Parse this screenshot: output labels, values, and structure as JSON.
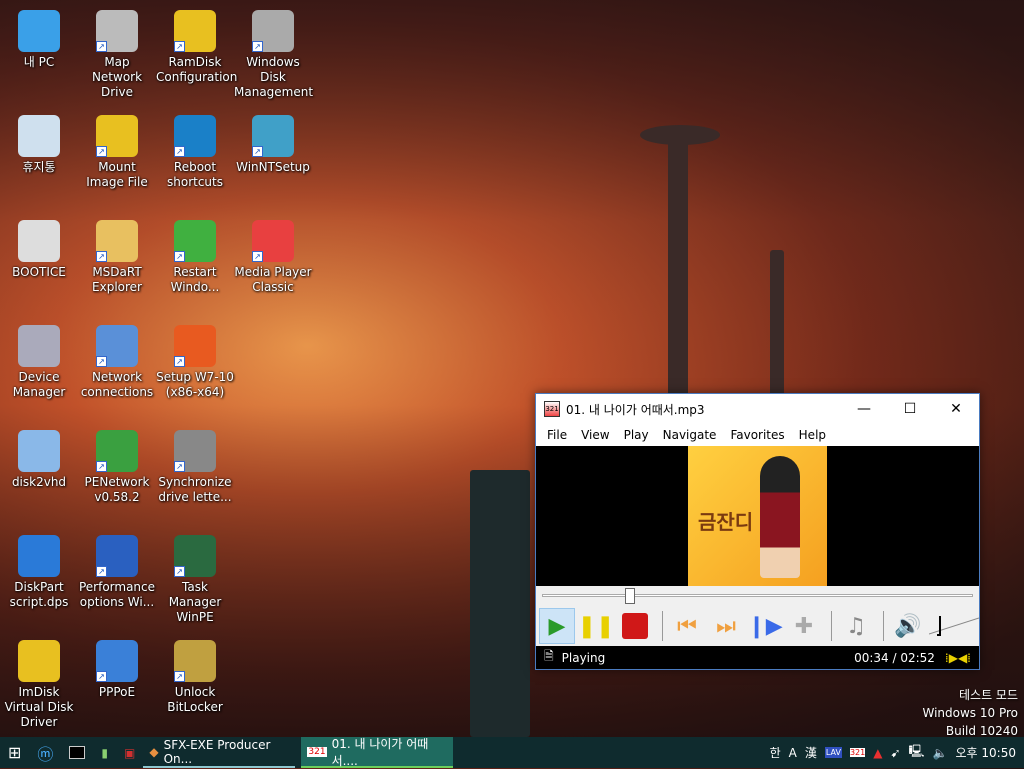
{
  "desktop": {
    "icons": [
      {
        "label": "내 PC",
        "col": 0,
        "row": 0,
        "color": "#3aa0e8",
        "shortcut": false
      },
      {
        "label": "휴지통",
        "col": 0,
        "row": 1,
        "color": "#cfe0ee",
        "shortcut": false
      },
      {
        "label": "BOOTICE",
        "col": 0,
        "row": 2,
        "color": "#ddd",
        "shortcut": false
      },
      {
        "label": "Device Manager",
        "col": 0,
        "row": 3,
        "color": "#aab",
        "shortcut": false
      },
      {
        "label": "disk2vhd",
        "col": 0,
        "row": 4,
        "color": "#8ab8e8",
        "shortcut": false
      },
      {
        "label": "DiskPart script.dps",
        "col": 0,
        "row": 5,
        "color": "#2a7ad8",
        "shortcut": false
      },
      {
        "label": "ImDisk Virtual Disk Driver",
        "col": 0,
        "row": 6,
        "color": "#e8c020",
        "shortcut": false
      },
      {
        "label": "Map Network Drive",
        "col": 1,
        "row": 0,
        "color": "#bbb",
        "shortcut": true
      },
      {
        "label": "Mount Image File",
        "col": 1,
        "row": 1,
        "color": "#e8c020",
        "shortcut": true
      },
      {
        "label": "MSDaRT Explorer",
        "col": 1,
        "row": 2,
        "color": "#e8c060",
        "shortcut": true
      },
      {
        "label": "Network connections",
        "col": 1,
        "row": 3,
        "color": "#5a90d8",
        "shortcut": true
      },
      {
        "label": "PENetwork v0.58.2",
        "col": 1,
        "row": 4,
        "color": "#3aa040",
        "shortcut": true
      },
      {
        "label": "Performance options Wi...",
        "col": 1,
        "row": 5,
        "color": "#2a60c0",
        "shortcut": true
      },
      {
        "label": "PPPoE",
        "col": 1,
        "row": 6,
        "color": "#3a80d8",
        "shortcut": true
      },
      {
        "label": "RamDisk Configuration",
        "col": 2,
        "row": 0,
        "color": "#e8c020",
        "shortcut": true
      },
      {
        "label": "Reboot shortcuts",
        "col": 2,
        "row": 1,
        "color": "#1a80c8",
        "shortcut": true
      },
      {
        "label": "Restart Windo...",
        "col": 2,
        "row": 2,
        "color": "#40b040",
        "shortcut": true
      },
      {
        "label": "Setup W7-10 (x86-x64)",
        "col": 2,
        "row": 3,
        "color": "#e85a20",
        "shortcut": true
      },
      {
        "label": "Synchronize drive lette...",
        "col": 2,
        "row": 4,
        "color": "#888",
        "shortcut": true
      },
      {
        "label": "Task Manager WinPE",
        "col": 2,
        "row": 5,
        "color": "#2a6a40",
        "shortcut": true
      },
      {
        "label": "Unlock BitLocker",
        "col": 2,
        "row": 6,
        "color": "#c0a040",
        "shortcut": true
      },
      {
        "label": "Windows Disk Management",
        "col": 3,
        "row": 0,
        "color": "#aaa",
        "shortcut": true
      },
      {
        "label": "WinNTSetup",
        "col": 3,
        "row": 1,
        "color": "#40a0c8",
        "shortcut": true
      },
      {
        "label": "Media Player Classic",
        "col": 3,
        "row": 2,
        "color": "#e84040",
        "shortcut": true
      }
    ]
  },
  "player": {
    "title": "01. 내 나이가 어때서.mp3",
    "menu": [
      "File",
      "View",
      "Play",
      "Navigate",
      "Favorites",
      "Help"
    ],
    "art_text": "금잔디",
    "seek_fraction": 0.198,
    "volume_fraction": 0.15,
    "status": "Playing",
    "time": "00:34 / 02:52"
  },
  "taskbar": {
    "tasks": [
      {
        "label": "SFX-EXE Producer On...",
        "active": false
      },
      {
        "label": "01. 내 나이가 어때서....",
        "active": true
      }
    ],
    "tray": [
      "한",
      "A",
      "漢"
    ],
    "clock": "오후 10:50"
  },
  "watermark": [
    "테스트 모드",
    "Windows 10 Pro",
    "Build 10240"
  ]
}
